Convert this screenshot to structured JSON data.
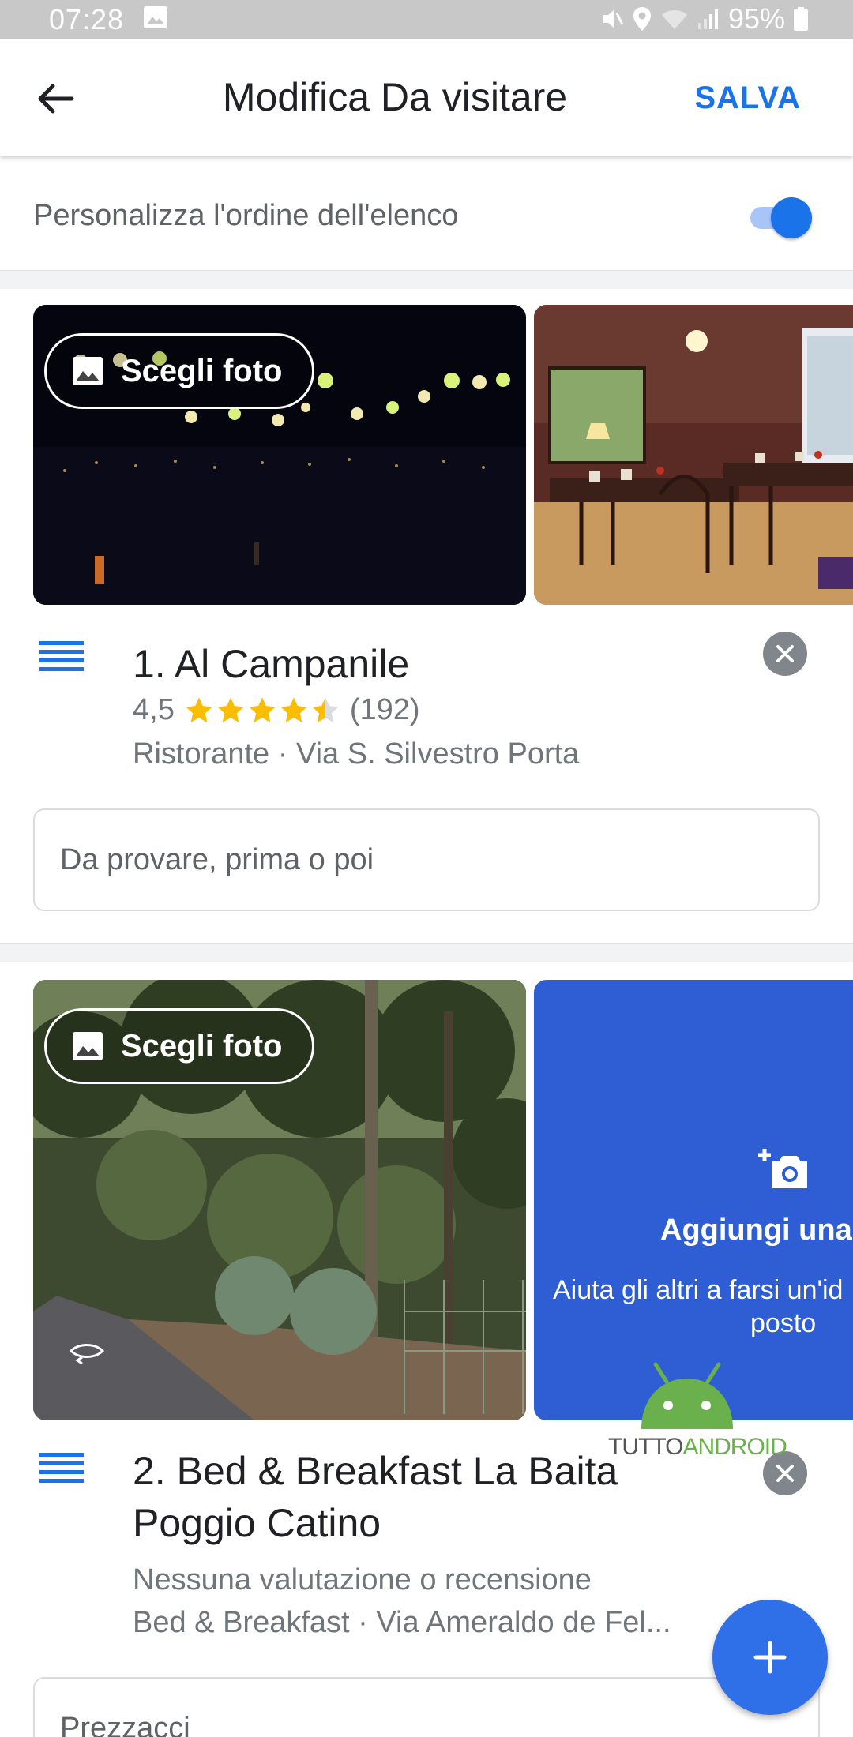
{
  "status_bar": {
    "time": "07:28",
    "battery": "95%",
    "icons": [
      "image-icon",
      "mute-icon",
      "location-icon",
      "wifi-icon",
      "signal-icon",
      "battery-icon"
    ]
  },
  "app_bar": {
    "title": "Modifica Da visitare",
    "save_label": "SALVA",
    "back_icon": "arrow-back-icon"
  },
  "reorder": {
    "label": "Personalizza l'ordine dell'elenco",
    "toggle_on": true
  },
  "places": [
    {
      "title": "1. Al Campanile",
      "rating": "4,5",
      "rating_value": 4.5,
      "reviews": "(192)",
      "category_address": "Ristorante · Via S. Silvestro Porta",
      "choose_photo_label": "Scegli foto",
      "note_placeholder": "Da provare, prima o poi"
    },
    {
      "title_line1": "2. Bed & Breakfast La Baita",
      "title_line2": "Poggio Catino",
      "no_rating": "Nessuna valutazione o recensione",
      "category_address": "Bed & Breakfast · Via Ameraldo de Fel...",
      "choose_photo_label": "Scegli foto",
      "add_photo_title": "Aggiungi una f",
      "add_photo_sub_line1": "Aiuta gli altri a farsi un'id",
      "add_photo_sub_line2": "posto",
      "note_placeholder": "Prezzacci"
    }
  ],
  "watermark": {
    "part1": "TUTTO",
    "part2": "ANDROID"
  },
  "colors": {
    "accent": "#1a73e8",
    "star": "#fbbc04",
    "add_photo_panel": "#2f5ed4",
    "fab": "#2f6fe8"
  }
}
